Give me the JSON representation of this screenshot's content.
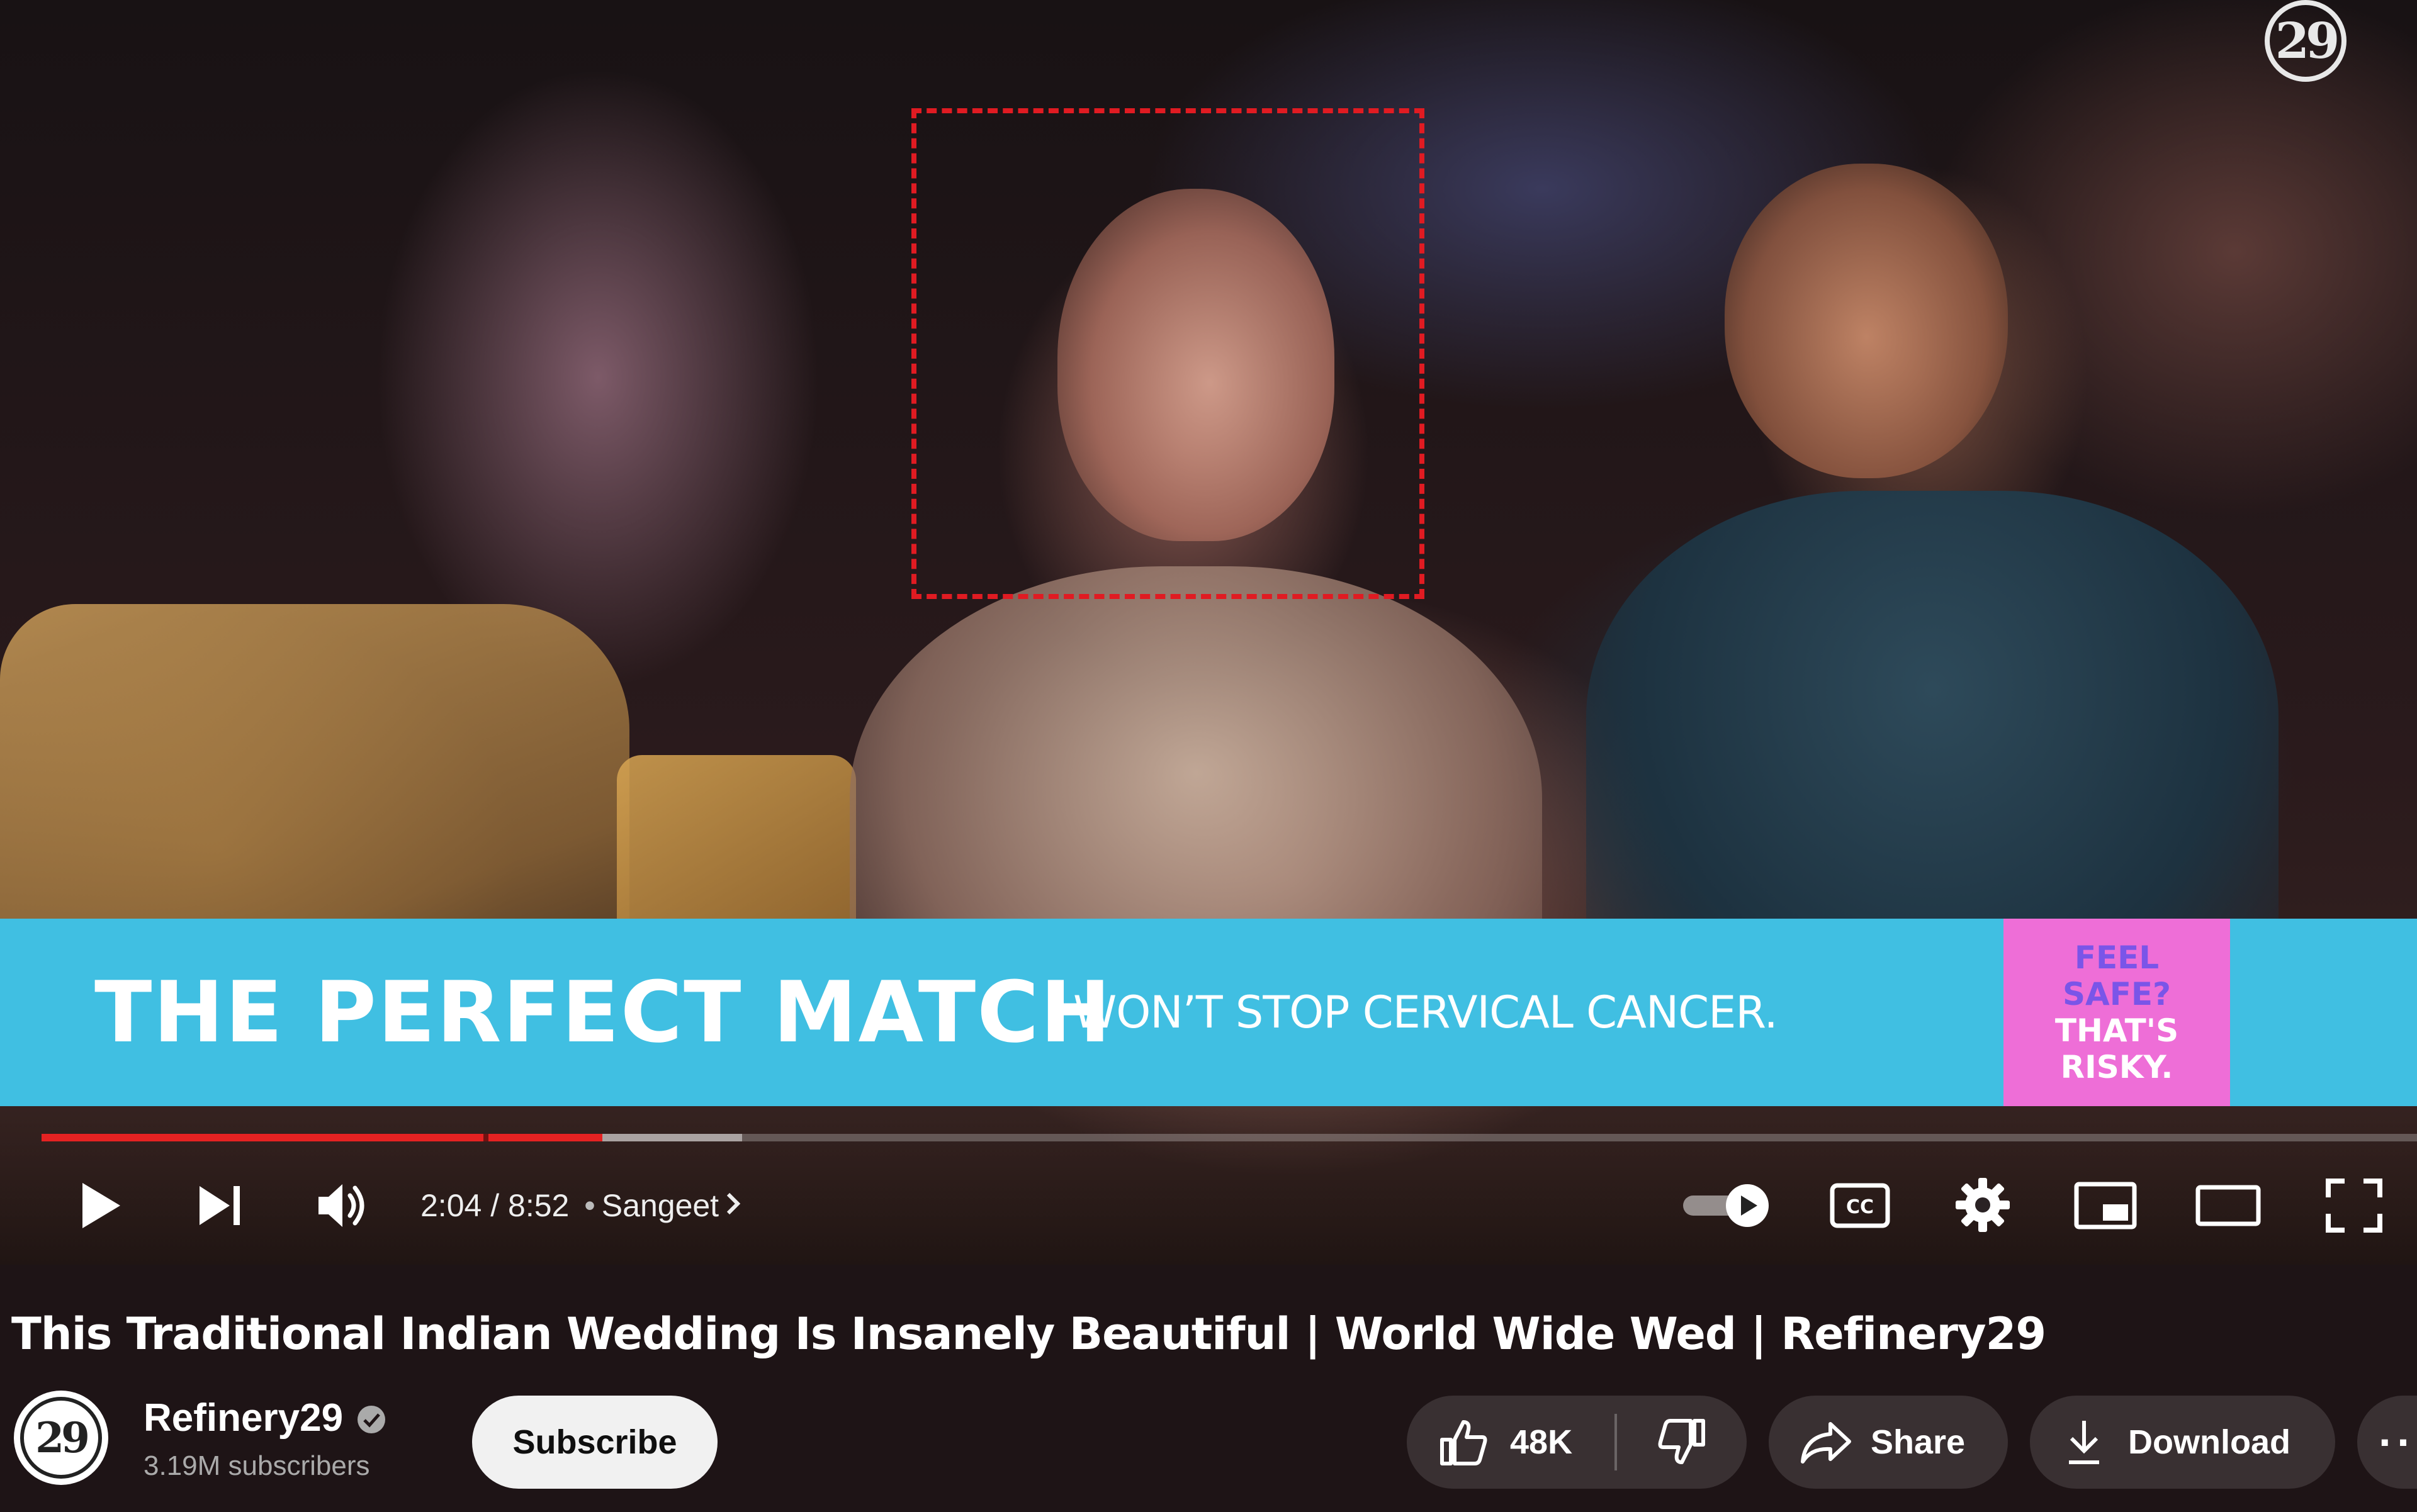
{
  "watermark": {
    "logo_text": "29"
  },
  "ad": {
    "headline": "THE PERFECT MATCH",
    "subline": "WON’T STOP CERVICAL CANCER.",
    "badge_line1": "FEEL",
    "badge_line2": "SAFE?",
    "badge_line3": "THAT'S",
    "badge_line4": "RISKY.",
    "colors": {
      "banner": "#40bfe2",
      "badge": "#ee6ed7",
      "badge_accent": "#7a55e8"
    }
  },
  "player": {
    "progress_fraction": 0.236,
    "buffer_fraction": 0.295,
    "current_time": "2:04",
    "duration": "8:52",
    "time_separator": "/",
    "chapter_bullet": "•",
    "chapter": "Sangeet",
    "accent_color": "#e52222"
  },
  "video": {
    "title": "This Traditional Indian Wedding Is Insanely Beautiful | World Wide Wed | Refinery29"
  },
  "channel": {
    "name": "Refinery29",
    "subscribers": "3.19M subscribers",
    "avatar_text": "29",
    "subscribe_label": "Subscribe"
  },
  "actions": {
    "like_count": "48K",
    "share_label": "Share",
    "download_label": "Download",
    "more_label": "···"
  }
}
